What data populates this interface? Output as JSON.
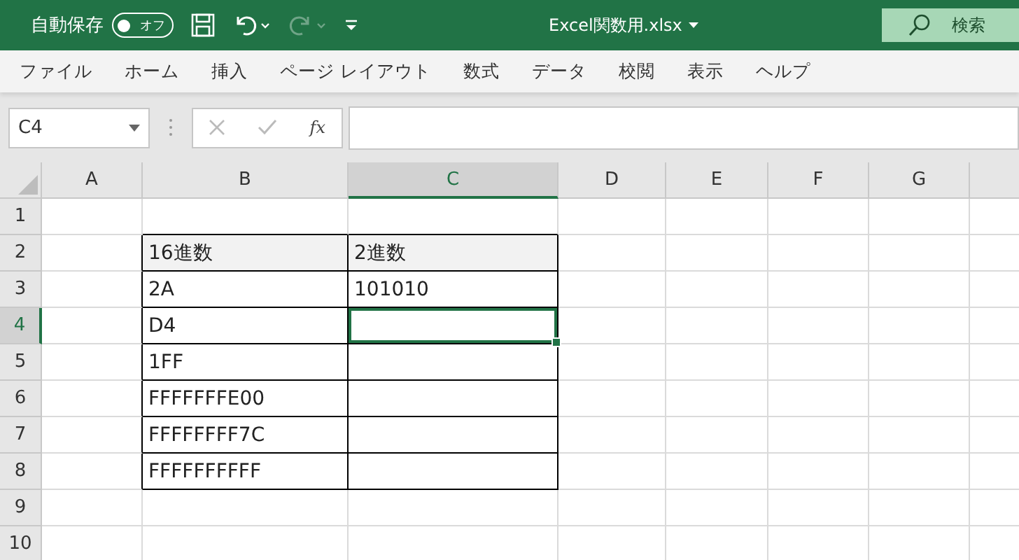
{
  "title_bar": {
    "autosave_label": "自動保存",
    "autosave_toggle": {
      "label": "オフ",
      "on": false
    },
    "redo_disabled": true,
    "filename": "Excel関数用.xlsx",
    "search": {
      "placeholder": "検索"
    }
  },
  "ribbon_tabs": [
    "ファイル",
    "ホーム",
    "挿入",
    "ページ レイアウト",
    "数式",
    "データ",
    "校閲",
    "表示",
    "ヘルプ"
  ],
  "formula_bar": {
    "name_box": "C4",
    "function_button": "fx"
  },
  "sheet": {
    "columns": [
      {
        "label": "A",
        "selected": false
      },
      {
        "label": "B",
        "selected": false
      },
      {
        "label": "C",
        "selected": true
      },
      {
        "label": "D",
        "selected": false
      },
      {
        "label": "E",
        "selected": false
      },
      {
        "label": "F",
        "selected": false
      },
      {
        "label": "G",
        "selected": false
      },
      {
        "selected": false
      }
    ],
    "rows": [
      {
        "label": "1",
        "selected": false
      },
      {
        "label": "2",
        "selected": false
      },
      {
        "label": "3",
        "selected": false
      },
      {
        "label": "4",
        "selected": true
      },
      {
        "label": "5",
        "selected": false
      },
      {
        "label": "6",
        "selected": false
      },
      {
        "label": "7",
        "selected": false
      },
      {
        "label": "8",
        "selected": false
      },
      {
        "label": "9",
        "selected": false
      },
      {
        "label": "10",
        "selected": false
      }
    ],
    "table": {
      "header": {
        "hex": "16進数",
        "binary": "2進数"
      },
      "rows": [
        {
          "hex": "2A",
          "binary": "101010"
        },
        {
          "hex": "D4"
        },
        {
          "hex": "1FF"
        },
        {
          "hex": "FFFFFFFE00"
        },
        {
          "hex": "FFFFFFFF7C"
        },
        {
          "hex": "FFFFFFFFFF"
        }
      ]
    }
  }
}
